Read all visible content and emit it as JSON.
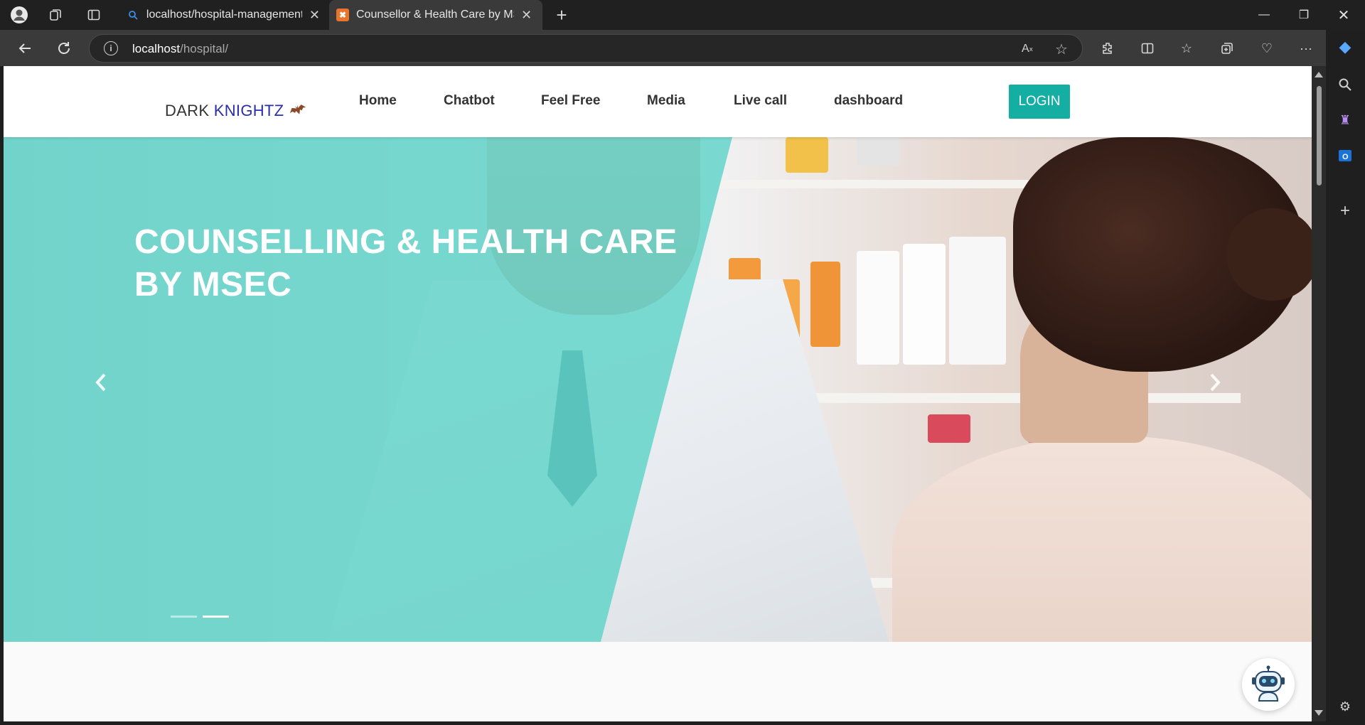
{
  "browser": {
    "tabs": [
      {
        "title": "localhost/hospital-management-s",
        "active": false
      },
      {
        "title": "Counsellor & Health Care by MSE",
        "active": true
      }
    ],
    "url_host": "localhost",
    "url_path": "/hospital/"
  },
  "site": {
    "brand_part1": "DARK ",
    "brand_part2": "KNIGHTZ",
    "nav": [
      "Home",
      "Chatbot",
      "Feel Free",
      "Media",
      "Live call",
      "dashboard"
    ],
    "login_label": "LOGIN"
  },
  "hero": {
    "title": "COUNSELLING & HEALTH CARE BY MSEC",
    "slide_count": 2,
    "active_slide": 2
  },
  "colors": {
    "accent": "#15aea3",
    "overlay": "#5ed3c8",
    "brand_highlight": "#2a2fa8"
  }
}
